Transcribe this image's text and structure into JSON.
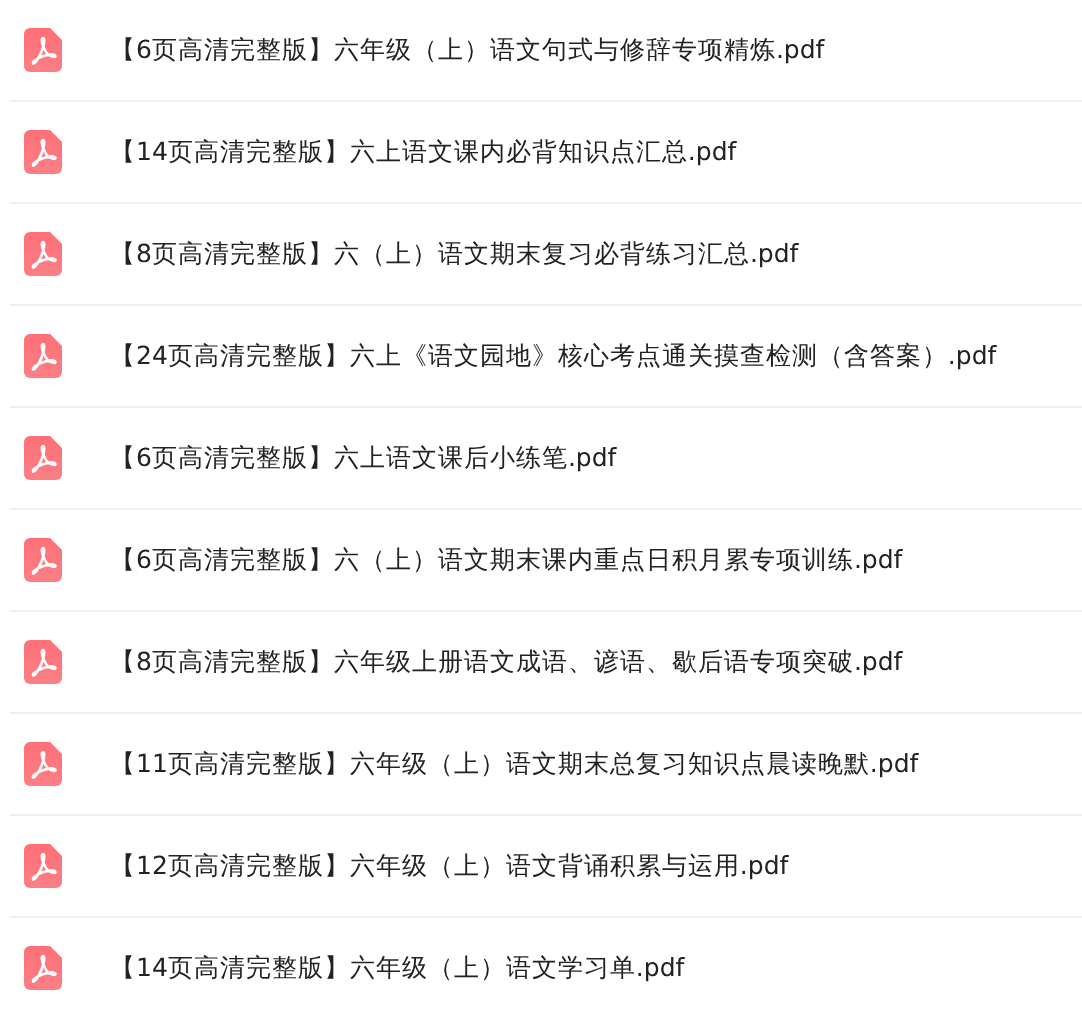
{
  "files": [
    {
      "name": "【6页高清完整版】六年级（上）语文句式与修辞专项精炼.pdf"
    },
    {
      "name": "【14页高清完整版】六上语文课内必背知识点汇总.pdf"
    },
    {
      "name": "【8页高清完整版】六（上）语文期末复习必背练习汇总.pdf"
    },
    {
      "name": "【24页高清完整版】六上《语文园地》核心考点通关摸查检测（含答案）.pdf"
    },
    {
      "name": "【6页高清完整版】六上语文课后小练笔.pdf"
    },
    {
      "name": "【6页高清完整版】六（上）语文期末课内重点日积月累专项训练.pdf"
    },
    {
      "name": "【8页高清完整版】六年级上册语文成语、谚语、歇后语专项突破.pdf"
    },
    {
      "name": "【11页高清完整版】六年级（上）语文期末总复习知识点晨读晚默.pdf"
    },
    {
      "name": "【12页高清完整版】六年级（上）语文背诵积累与运用.pdf"
    },
    {
      "name": "【14页高清完整版】六年级（上）语文学习单.pdf"
    }
  ]
}
